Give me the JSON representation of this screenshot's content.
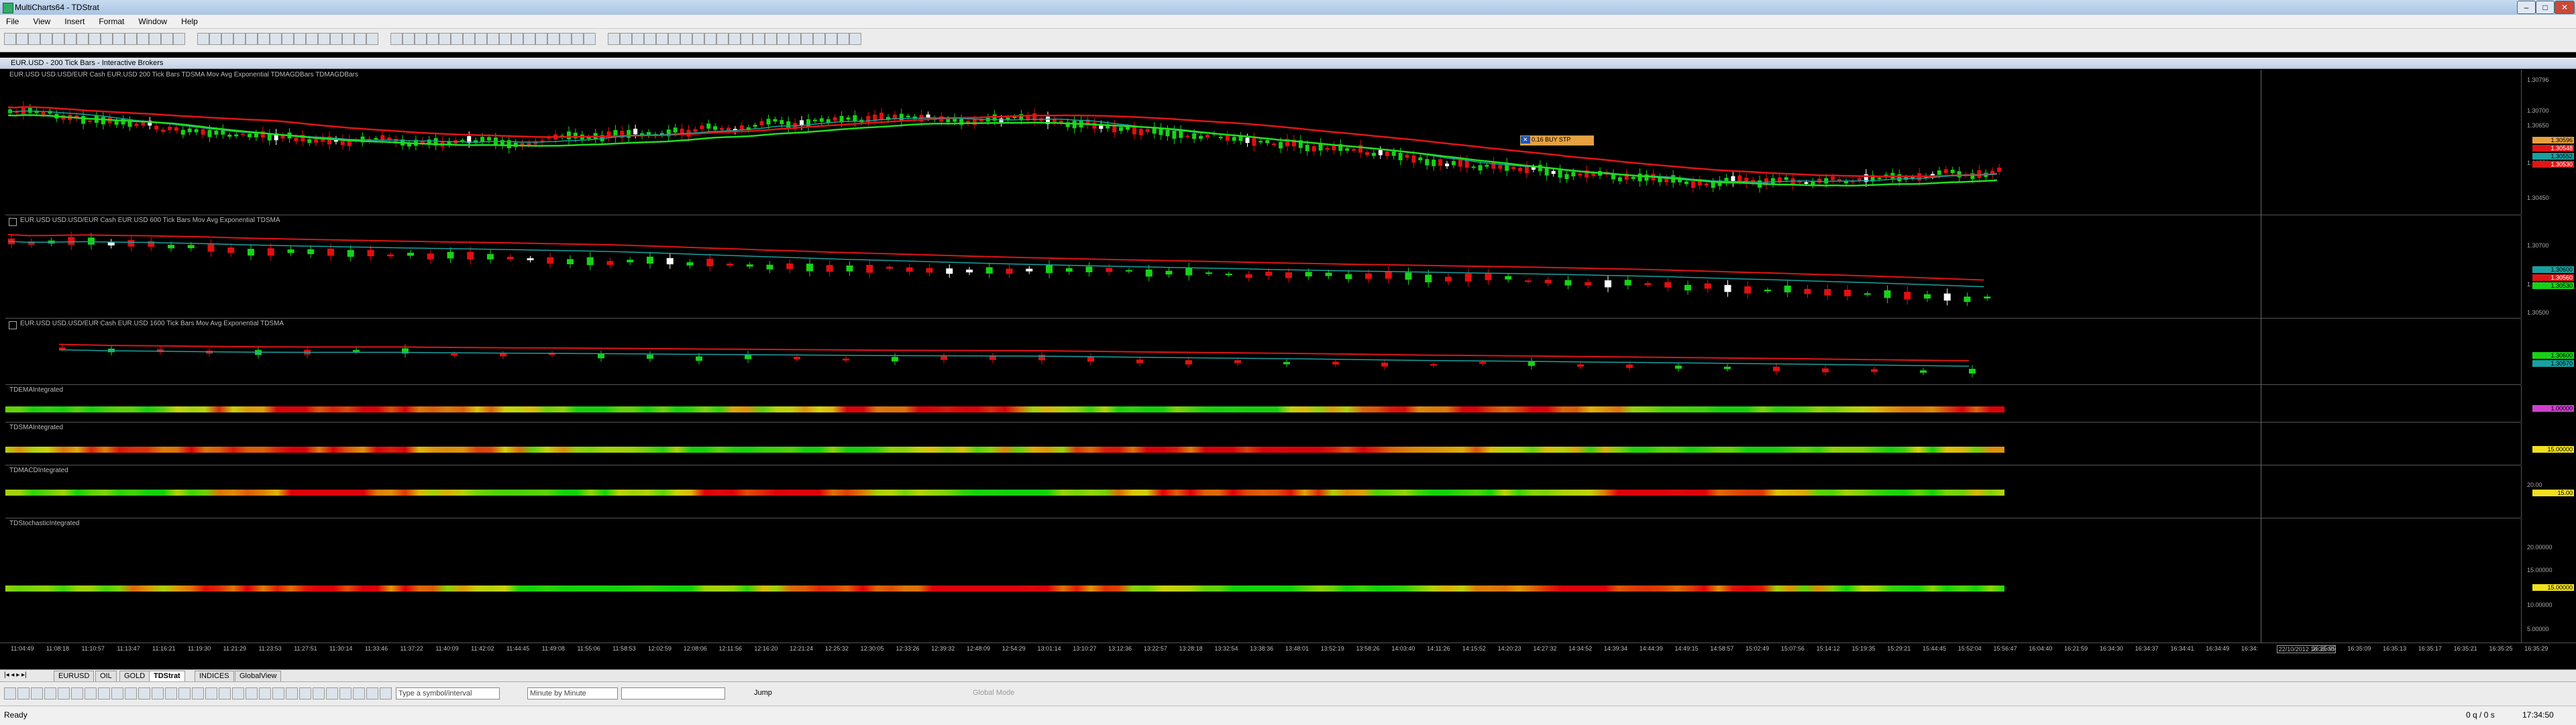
{
  "window": {
    "title": "MultiCharts64 - TDStrat"
  },
  "menu": [
    "File",
    "View",
    "Insert",
    "Format",
    "Window",
    "Help"
  ],
  "document": {
    "title": "EUR.USD - 200 Tick Bars - Interactive Brokers"
  },
  "panes": [
    {
      "label": "EUR.USD   USD.USD/EUR Cash EUR.USD 200 Tick Bars    TDSMA   Mov Avg Exponential   TDMAGDBars   TDMAGDBars",
      "axis": [
        "1.30796",
        "1.30700",
        "1.30650",
        "1.30550",
        "1.30450"
      ],
      "tags": [
        "1.30596",
        "1.30548",
        "1.30552",
        "1.30530"
      ],
      "order_label": "0.16   BUY STP"
    },
    {
      "label": "EUR.USD   USD.USD/EUR Cash EUR.USD 600 Tick Bars    Mov Avg Exponential   TDSMA",
      "axis": [
        "1.30700",
        "1.30600",
        "1.30500"
      ],
      "tags": [
        "1.30600",
        "1.30560",
        "1.30530"
      ]
    },
    {
      "label": "EUR.USD   USD.USD/EUR Cash EUR.USD 1600 Tick Bars    Mov Avg Exponential   TDSMA",
      "axis": [],
      "tags": [
        "1.30600",
        "1.30570"
      ]
    },
    {
      "label": "TDEMAIntegrated",
      "axis": [],
      "tags": [
        "1.00000"
      ]
    },
    {
      "label": "TDSMAIntegrated",
      "axis": [],
      "tags": [
        "15.00000"
      ]
    },
    {
      "label": "TDMACDIntegrated",
      "axis": [
        "20.00"
      ],
      "tags": [
        "15.00"
      ]
    },
    {
      "label": "TDStochasticIntegrated",
      "axis": [
        "20.00000",
        "15.00000",
        "10.00000",
        "5.00000"
      ],
      "tags": [
        "15.00000"
      ]
    }
  ],
  "time_axis": [
    "11:04:49",
    "11:08:18",
    "11:10:57",
    "11:13:47",
    "11:16:21",
    "11:19:30",
    "11:21:29",
    "11:23:53",
    "11:27:51",
    "11:30:14",
    "11:33:46",
    "11:37:22",
    "11:40:09",
    "11:42:02",
    "11:44:45",
    "11:49:08",
    "11:55:06",
    "11:58:53",
    "12:02:59",
    "12:08:06",
    "12:11:56",
    "12:16:20",
    "12:21:24",
    "12:25:32",
    "12:30:05",
    "12:33:26",
    "12:39:32",
    "12:48:09",
    "12:54:29",
    "13:01:14",
    "13:10:27",
    "13:12:36",
    "13:22:57",
    "13:28:18",
    "13:32:54",
    "13:38:36",
    "13:48:01",
    "13:52:19",
    "13:58:26",
    "14:03:40",
    "14:11:26",
    "14:15:52",
    "14:20:23",
    "14:27:32",
    "14:34:52",
    "14:39:34",
    "14:44:39",
    "14:49:15",
    "14:58:57",
    "15:02:49",
    "15:07:56",
    "15:14:12",
    "15:19:35",
    "15:29:21",
    "15:44:45",
    "15:52:04",
    "15:56:47",
    "16:04:40",
    "16:21:59",
    "16:34:30",
    "16:34:37",
    "16:34:41",
    "16:34:49",
    "16:34:",
    "22/10/2012 16:35:00",
    "16:35:05",
    "16:35:09",
    "16:35:13",
    "16:35:17",
    "16:35:21",
    "16:35:25",
    "16:35:29"
  ],
  "tabs": [
    "EURUSD",
    "OIL",
    "GOLD",
    "TDStrat",
    "INDICES",
    "GlobalView"
  ],
  "active_tab": "TDStrat",
  "drawbar": {
    "symbol_placeholder": "Type a symbol/interval",
    "interval": "Minute by Minute",
    "jump": "Jump",
    "global_mode": "Global Mode"
  },
  "status": {
    "left": "Ready",
    "right1": "0 q / 0 s",
    "clock": "17:34:50"
  },
  "colors": {
    "bull": "#17d317",
    "bear": "#e01010",
    "doji": "#ffffff",
    "ema_red": "#e01515",
    "ema_cyan": "#1aa0a0",
    "ema_green": "#22dd22"
  }
}
